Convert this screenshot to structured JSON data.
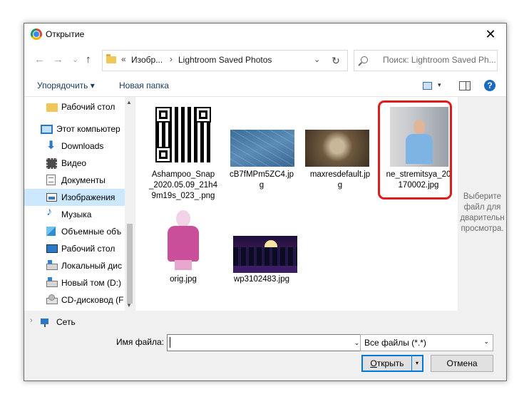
{
  "window": {
    "title": "Открытие",
    "close_glyph": "✕",
    "title_icon": "chrome-icon"
  },
  "nav": {
    "back": "←",
    "forward": "→",
    "recent": "⌄",
    "up": "↑",
    "address": {
      "prefix": "«",
      "segments": [
        "Изобр...",
        "Lightroom Saved Photos"
      ],
      "separator": "›",
      "dropdown": "⌄"
    },
    "refresh": "↻",
    "search_placeholder": "Поиск: Lightroom Saved Ph..."
  },
  "toolbar": {
    "organize": "Упорядочить ▾",
    "new_folder": "Новая папка",
    "view_dropdown": "▾",
    "help": "?"
  },
  "sidebar": {
    "items": [
      {
        "label": "Рабочий стол",
        "icon": "folder-icon"
      },
      {
        "label": "Этот компьютер",
        "icon": "computer-icon",
        "chevron": "⌄"
      },
      {
        "label": "Downloads",
        "icon": "download-icon",
        "glyph": "⬇"
      },
      {
        "label": "Видео",
        "icon": "video-icon"
      },
      {
        "label": "Документы",
        "icon": "documents-icon"
      },
      {
        "label": "Изображения",
        "icon": "images-icon",
        "selected": true
      },
      {
        "label": "Музыка",
        "icon": "music-icon",
        "glyph": "♪"
      },
      {
        "label": "Объемные объ",
        "icon": "3d-objects-icon"
      },
      {
        "label": "Рабочий стол",
        "icon": "desktop-icon"
      },
      {
        "label": "Локальный дис",
        "icon": "local-disk-icon"
      },
      {
        "label": "Новый том (D:)",
        "icon": "drive-icon"
      },
      {
        "label": "CD-дисковод (F",
        "icon": "cd-drive-icon"
      },
      {
        "label": "Сеть",
        "icon": "network-icon",
        "chevron": "›"
      }
    ],
    "scroll_up": "▲",
    "scroll_down": "▼"
  },
  "files": [
    {
      "name": "Ashampoo_Snap_2020.05.09_21h49m19s_023_.png",
      "line1": "Ashampoo_Snap",
      "line2": "_2020.05.09_21h4",
      "line3": "9m19s_023_.png"
    },
    {
      "name": "cB7fMPm5ZC4.jpg",
      "line1": "cB7fMPm5ZC4.jp",
      "line2": "g"
    },
    {
      "name": "maxresdefault.jpg",
      "line1": "maxresdefault.jp",
      "line2": "g"
    },
    {
      "name": "ne_stremitsya_20170002.jpg",
      "line1": "ne_stremitsya_20",
      "line2": "170002.jpg",
      "highlighted": true
    },
    {
      "name": "orig.jpg",
      "line1": "orig.jpg"
    },
    {
      "name": "wp3102483.jpg",
      "line1": "wp3102483.jpg"
    }
  ],
  "preview": {
    "line1": "Выберите",
    "line2": "файл для",
    "line3": "дварительн",
    "line4": "просмотра."
  },
  "bottom": {
    "filename_label": "Имя файла:",
    "filename_value": "",
    "filename_drop": "⌄",
    "filetype_value": "Все файлы (*.*)",
    "filetype_drop": "⌄",
    "open_label_ul": "О",
    "open_label_rest": "ткрыть",
    "open_split": "▾",
    "cancel_label": "Отмена"
  },
  "colors": {
    "selection": "#cce8ff",
    "highlight_border": "#e01b1b",
    "accent": "#0078d7"
  }
}
